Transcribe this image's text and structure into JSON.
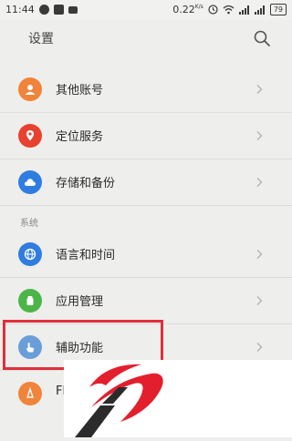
{
  "status_bar": {
    "time": "11:44",
    "data_rate": "0.22",
    "data_rate_unit": "K/s",
    "battery": "79"
  },
  "header": {
    "title": "设置"
  },
  "sections": [
    {
      "items": [
        {
          "label": "其他账号",
          "icon": "account-icon",
          "color": "#f0843a"
        },
        {
          "label": "定位服务",
          "icon": "location-icon",
          "color": "#e8412f"
        },
        {
          "label": "存储和备份",
          "icon": "cloud-icon",
          "color": "#2f7de0"
        }
      ]
    },
    {
      "title": "系统",
      "items": [
        {
          "label": "语言和时间",
          "icon": "globe-icon",
          "color": "#2f7de0"
        },
        {
          "label": "应用管理",
          "icon": "apps-icon",
          "color": "#4cb548"
        },
        {
          "label": "辅助功能",
          "icon": "hand-icon",
          "color": "#6a9ed8"
        },
        {
          "label": "Fl",
          "icon": "flyme-icon",
          "color": "#f0843a"
        }
      ]
    }
  ],
  "colors": {
    "highlight": "#e0303a",
    "background": "#eeeeec",
    "logo_red": "#e41f2d",
    "logo_dark": "#2b2b2b"
  }
}
